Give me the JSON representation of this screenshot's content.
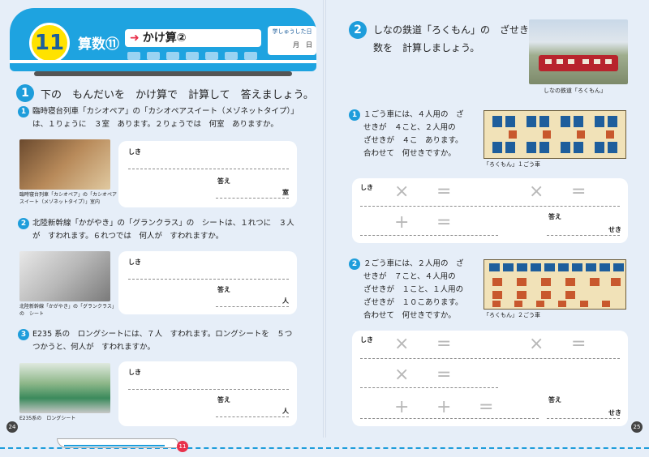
{
  "header": {
    "number": "11",
    "subject": "算数⑪",
    "topic": "かけ算②",
    "date_label": "学しゅうした日",
    "date_value": "月　日"
  },
  "left": {
    "instruction_num": "1",
    "instruction": "下の　もんだいを　かけ算で　計算して　答えましょう。",
    "questions": [
      {
        "num": "1",
        "text": "臨時寝台列車「カシオペア」の「カシオペアスイート（メゾネットタイプ）」は、１りょうに　３室　あります。２りょうでは　何室　ありますか。",
        "caption": "臨時寝台列車「カシオペア」の「カシオペアスイート（メゾネットタイプ）」室内",
        "shiki": "しき",
        "kotae": "答え",
        "unit": "室"
      },
      {
        "num": "2",
        "text": "北陸新幹線「かがやき」の「グランクラス」の　シートは、１れつに　３人が　すわれます。６れつでは　何人が　すわれますか。",
        "caption": "北陸新幹線「かがやき」の「グランクラス」の　シート",
        "shiki": "しき",
        "kotae": "答え",
        "unit": "人"
      },
      {
        "num": "3",
        "text": "E235 系の　ロングシートには、７人　すわれます。ロングシートを　５つ　つかうと、何人が　すわれますか。",
        "caption": "E235系の　ロングシート",
        "shiki": "しき",
        "kotae": "答え",
        "unit": "人"
      }
    ],
    "page_number": "24"
  },
  "right": {
    "heading_num": "2",
    "heading": "しなの鉄道「ろくもん」の　ざせきの　数を　計算しましょう。",
    "photo_caption": "しなの鉄道「ろくもん」",
    "questions": [
      {
        "num": "1",
        "text": "１ごう車には、４人用の　ざせきが　４こと、２人用の　ざせきが　４こ　あります。合わせて　何せきですか。",
        "plan_caption": "「ろくもん」１ごう車",
        "shiki": "しき",
        "kotae": "答え",
        "unit": "せき"
      },
      {
        "num": "2",
        "text": "２ごう車には、２人用の　ざせきが　７こと、４人用の　ざせきが　１こと、１人用の　ざせきが　１０こあります。合わせて　何せきですか。",
        "plan_caption": "「ろくもん」２ごう車",
        "shiki": "しき",
        "kotae": "答え",
        "unit": "せき"
      }
    ],
    "symbols": {
      "times": "×",
      "equals": "=",
      "plus": "+"
    },
    "page_number": "25",
    "footer_mark": "11"
  }
}
